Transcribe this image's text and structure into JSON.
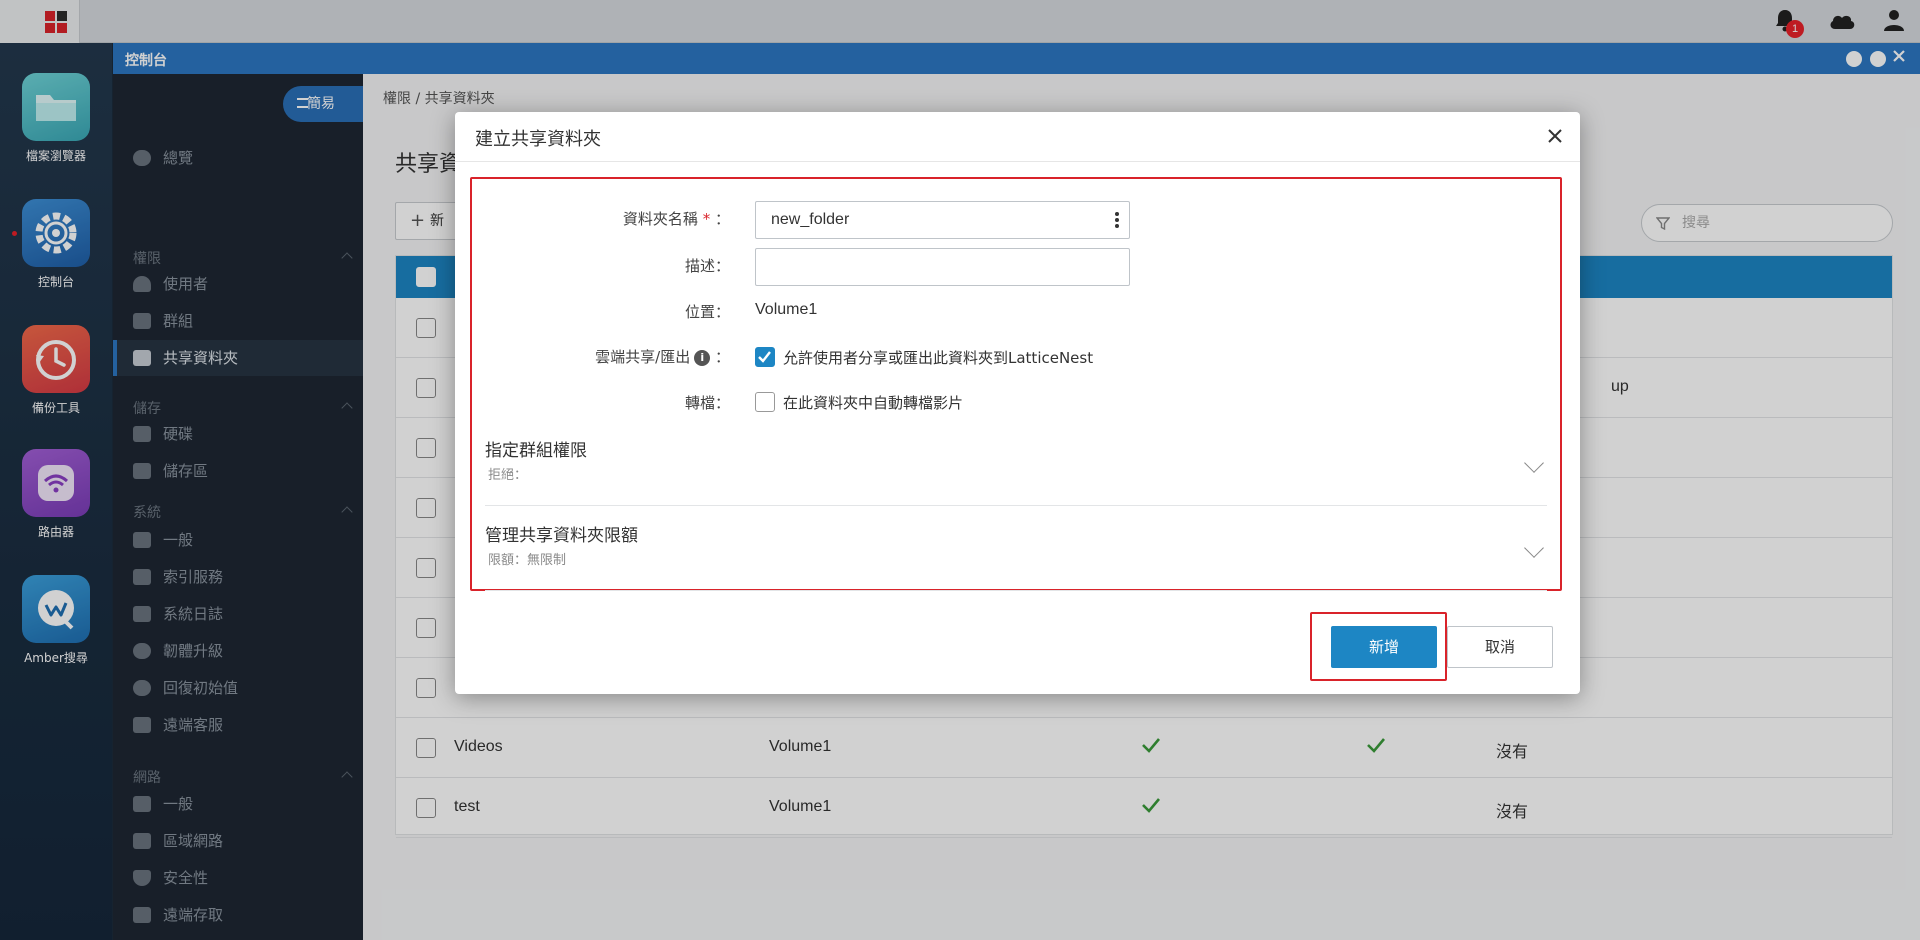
{
  "topbar": {
    "notification_count": "1"
  },
  "dock": {
    "items": [
      {
        "label": "檔案瀏覽器",
        "icon": "folder-icon",
        "color": "#4fbdc6"
      },
      {
        "label": "控制台",
        "icon": "gear-icon",
        "color": "#2a6fb8"
      },
      {
        "label": "備份工具",
        "icon": "backup-clock-icon",
        "color": "#e0503c"
      },
      {
        "label": "路由器",
        "icon": "wifi-icon",
        "color": "#8e4fc6"
      },
      {
        "label": "Amber搜尋",
        "icon": "amber-search-icon",
        "color": "#2f88c8"
      }
    ]
  },
  "window": {
    "title": "控制台"
  },
  "sidebar": {
    "mode_button": "簡易",
    "overview": "總覽",
    "sections": [
      {
        "title": "權限",
        "items": [
          "使用者",
          "群組",
          "共享資料夾"
        ]
      },
      {
        "title": "儲存",
        "items": [
          "硬碟",
          "儲存區"
        ]
      },
      {
        "title": "系統",
        "items": [
          "一般",
          "索引服務",
          "系統日誌",
          "韌體升級",
          "回復初始值",
          "遠端客服"
        ]
      },
      {
        "title": "網路",
        "items": [
          "一般",
          "區域網路",
          "安全性",
          "遠端存取"
        ]
      }
    ],
    "active_item": "共享資料夾"
  },
  "main": {
    "breadcrumb": "權限 / 共享資料夾",
    "title": "共享資",
    "new_button": "新",
    "search_placeholder": "搜尋",
    "partial_cell": "up",
    "rows": [
      {
        "name": "Videos",
        "location": "Volume1",
        "col3": true,
        "col4": true,
        "col5": "沒有"
      },
      {
        "name": "test",
        "location": "Volume1",
        "col3": true,
        "col4": false,
        "col5": "沒有"
      }
    ]
  },
  "dialog": {
    "title": "建立共享資料夾",
    "fields": {
      "name_label": "資料夾名稱",
      "name_value": "new_folder",
      "desc_label": "描述：",
      "desc_value": "",
      "location_label": "位置：",
      "location_value": "Volume1",
      "cloud_label": "雲端共享/匯出",
      "cloud_checkbox": "允許使用者分享或匯出此資料夾到LatticeNest",
      "cloud_checked": true,
      "transcode_label": "轉檔：",
      "transcode_checkbox": "在此資料夾中自動轉檔影片",
      "transcode_checked": false
    },
    "sections": [
      {
        "title": "指定群組權限",
        "subtitle": "拒絕："
      },
      {
        "title": "管理共享資料夾限額",
        "subtitle": "限額：無限制"
      }
    ],
    "buttons": {
      "confirm": "新增",
      "cancel": "取消"
    }
  },
  "colors": {
    "accent": "#1d86c4",
    "title_bar": "#2c77c2",
    "highlight": "#d9232a"
  }
}
